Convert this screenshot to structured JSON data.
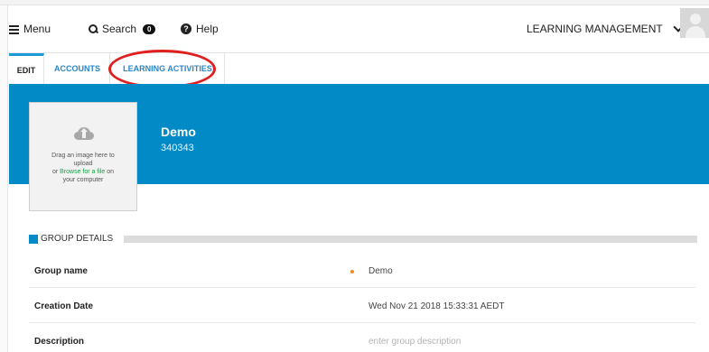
{
  "topbar": {
    "menu_label": "Menu",
    "search_label": "Search",
    "search_count": "0",
    "help_label": "Help",
    "help_icon": "?",
    "org_label": "LEARNING MANAGEMENT"
  },
  "tabs": [
    {
      "label": "EDIT",
      "active": true
    },
    {
      "label": "ACCOUNTS",
      "active": false
    },
    {
      "label": "LEARNING ACTIVITIES",
      "active": false
    }
  ],
  "group": {
    "name": "Demo",
    "id": "340343"
  },
  "upload": {
    "line1": "Drag an image here to",
    "line2": "upload",
    "or": "or",
    "browse": "Browse for a file",
    "on": "on",
    "line4": "your computer"
  },
  "details": {
    "title": "GROUP DETAILS",
    "rows": [
      {
        "label": "Group name",
        "value": "Demo"
      },
      {
        "label": "Creation Date",
        "value": "Wed Nov 21 2018 15:33:31 AEDT"
      },
      {
        "label": "Description",
        "placeholder": "enter group description"
      }
    ]
  },
  "colors": {
    "brand_blue": "#028ac6",
    "link_blue": "#2a86c6",
    "annotation_red": "#e02020",
    "required_orange": "#f08a24",
    "browse_green": "#1aa04a"
  }
}
